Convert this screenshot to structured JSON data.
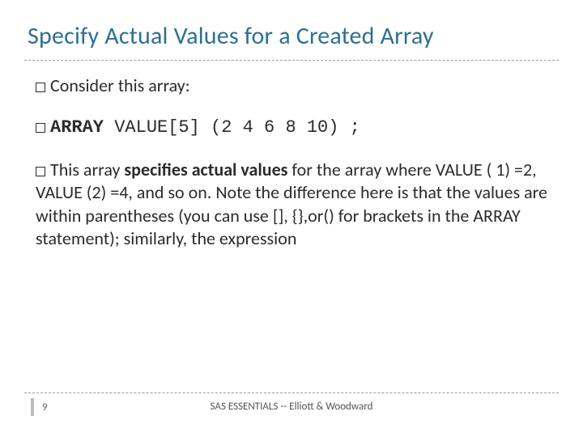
{
  "title": "Specify Actual Values for a Created Array",
  "bullets": {
    "intro": "Consider this array:",
    "code_kw": "ARRAY",
    "code_rest": " VALUE[5]  (2 4 6 8 10)  ;",
    "explain_lead": "This array ",
    "explain_bold": "specifies actual values",
    "explain_rest": " for the array where VALUE ( 1) =2, VALUE (2) =4, and so on. Note the difference here is that the values are within parentheses (you can use [], {},or() for brackets in the ARRAY statement); similarly, the expression"
  },
  "footer": {
    "page": "9",
    "credit": "SAS ESSENTIALS -- Elliott & Woodward"
  }
}
